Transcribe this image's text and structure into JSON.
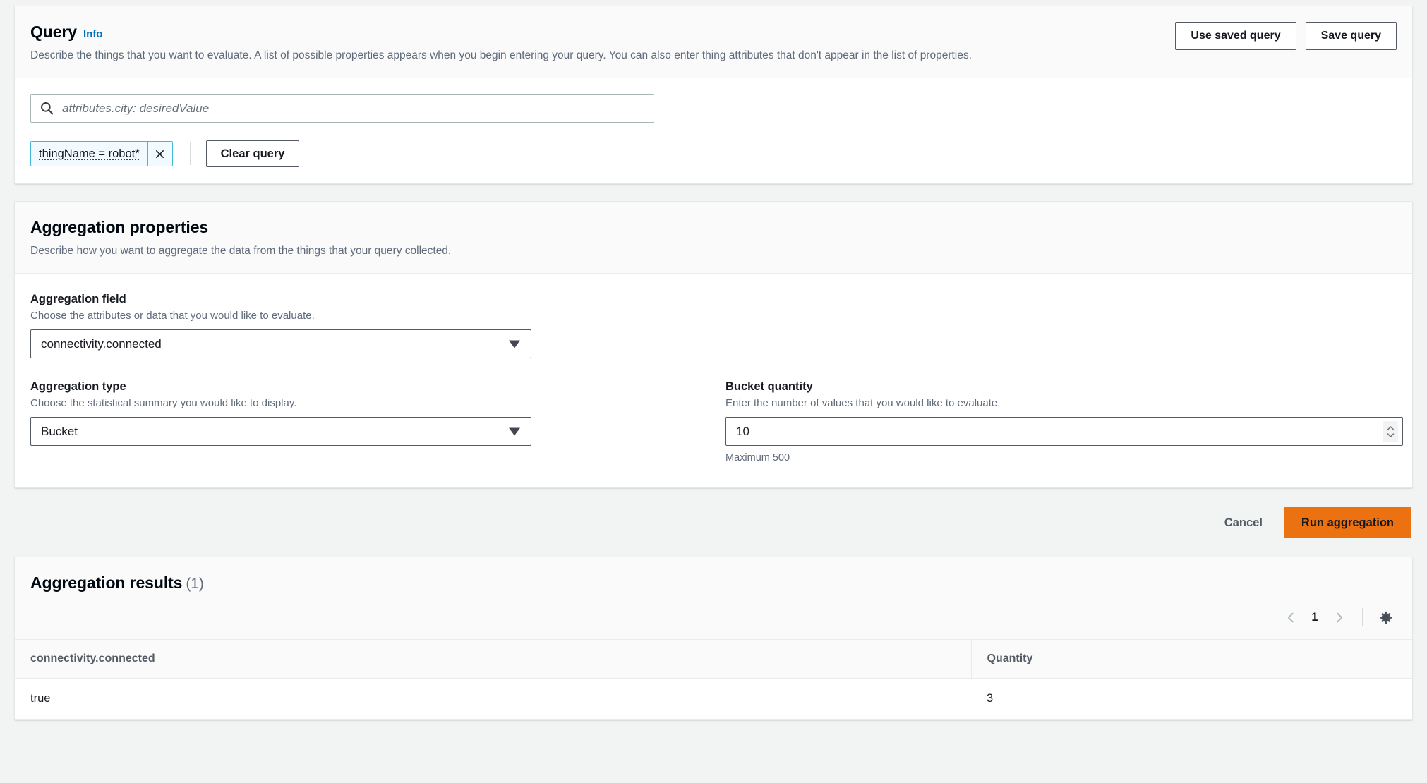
{
  "query_section": {
    "title": "Query",
    "info_link": "Info",
    "description": "Describe the things that you want to evaluate. A list of possible properties appears when you begin entering your query. You can also enter thing attributes that don't appear in the list of properties.",
    "use_saved_query_label": "Use saved query",
    "save_query_label": "Save query",
    "search_placeholder": "attributes.city: desiredValue",
    "search_value": "",
    "token_label": "thingName = robot*",
    "clear_query_label": "Clear query"
  },
  "aggregation_properties": {
    "title": "Aggregation properties",
    "description": "Describe how you want to aggregate the data from the things that your query collected.",
    "field": {
      "label": "Aggregation field",
      "hint": "Choose the attributes or data that you would like to evaluate.",
      "value": "connectivity.connected"
    },
    "type": {
      "label": "Aggregation type",
      "hint": "Choose the statistical summary you would like to display.",
      "value": "Bucket"
    },
    "bucket_quantity": {
      "label": "Bucket quantity",
      "hint": "Enter the number of values that you would like to evaluate.",
      "value": "10",
      "constraint": "Maximum 500"
    }
  },
  "actions": {
    "cancel_label": "Cancel",
    "run_label": "Run aggregation"
  },
  "results": {
    "title": "Aggregation results",
    "count": "(1)",
    "page_number": "1",
    "columns": [
      "connectivity.connected",
      "Quantity"
    ],
    "rows": [
      {
        "key": "true",
        "quantity": "3"
      }
    ]
  },
  "colors": {
    "accent_primary": "#ec7211",
    "link": "#0073bb",
    "token_border": "#44b9d6",
    "token_background": "#f1faff",
    "page_background": "#f2f3f3"
  }
}
